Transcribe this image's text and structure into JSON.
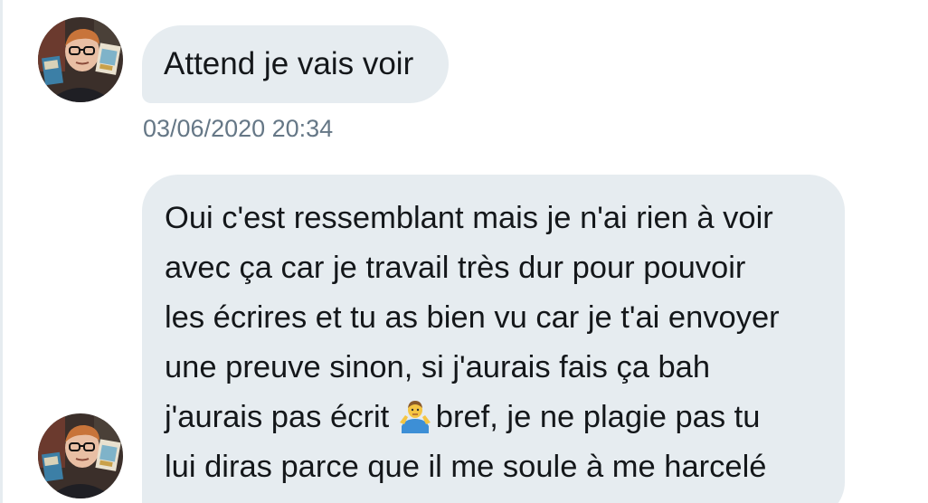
{
  "conversation": {
    "messages": [
      {
        "sender": "avatar",
        "text": "Attend je vais voir",
        "timestamp": "03/06/2020 20:34"
      },
      {
        "sender": "avatar",
        "lines": [
          "Oui c'est ressemblant mais je n'ai rien à voir",
          "avec ça car je travail très dur pour pouvoir",
          "les écrires et tu as bien vu car je t'ai envoyer",
          "une preuve sinon, si j'aurais fais ça bah",
          "j'aurais pas écrit ",
          "bref, je ne plagie pas tu",
          "lui diras parce que il me soule à me harcelé"
        ],
        "emoji": "man-shrugging-emoji"
      }
    ]
  },
  "colors": {
    "bubble_background": "#e6ecf0",
    "message_text": "#14171a",
    "timestamp_text": "#657786",
    "page_background": "#ffffff"
  },
  "icons": {
    "avatar": "profile-photo",
    "emoji": "man-shrugging-emoji"
  }
}
